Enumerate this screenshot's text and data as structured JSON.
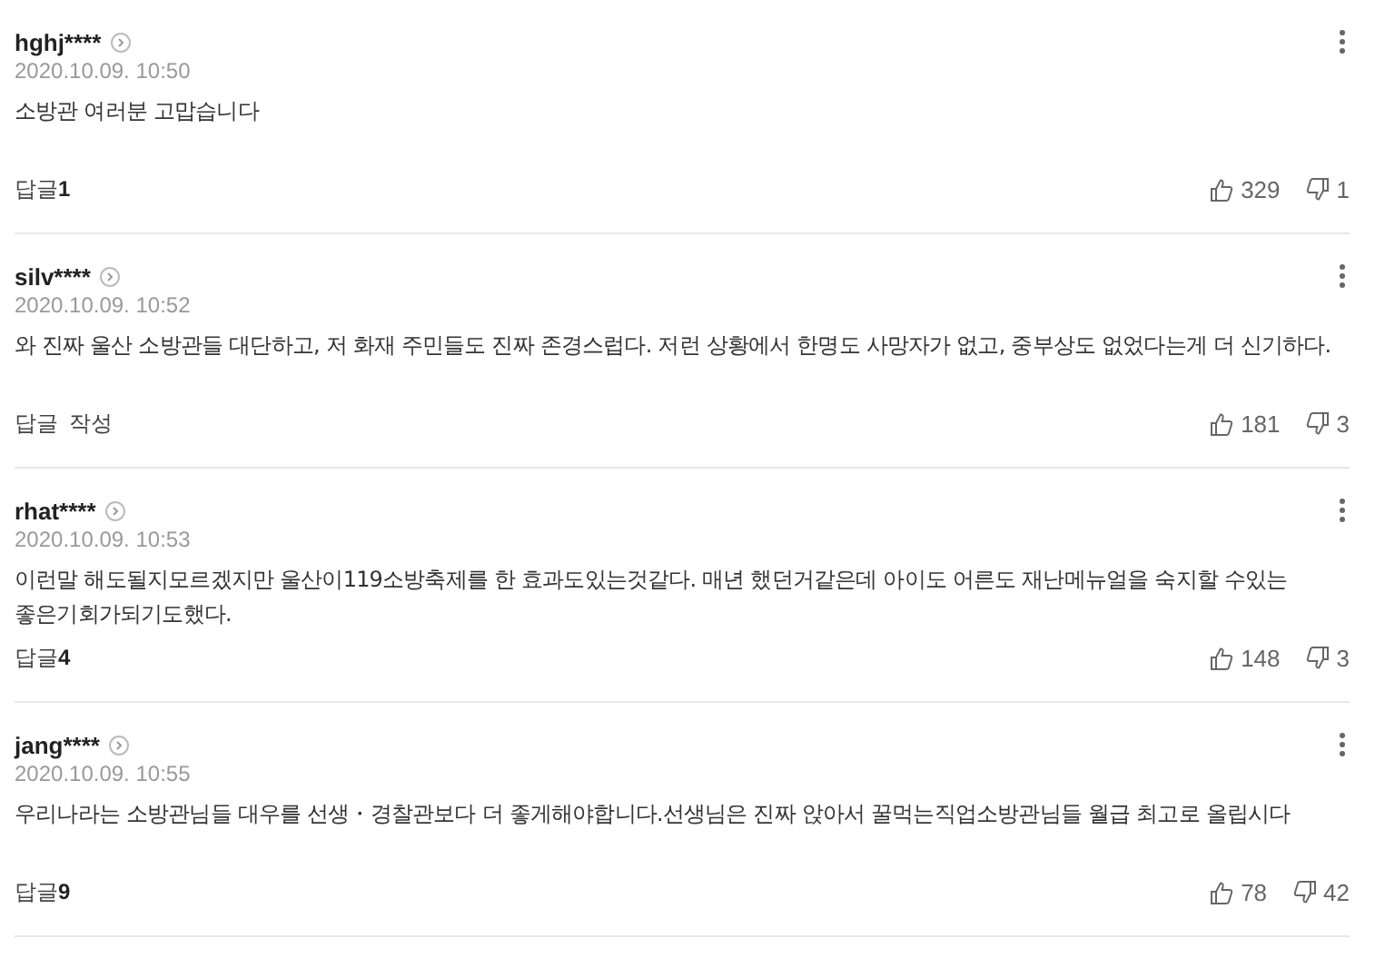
{
  "comments": [
    {
      "user": "hghj****",
      "date": "2020.10.09. 10:50",
      "text": "소방관 여러분 고맙습니다",
      "reply": {
        "label": "답글",
        "count": "1"
      },
      "likes": "329",
      "dislikes": "1"
    },
    {
      "user": "silv****",
      "date": "2020.10.09. 10:52",
      "text": "와 진짜 울산 소방관들 대단하고, 저 화재 주민들도 진짜 존경스럽다. 저런 상황에서 한명도 사망자가 없고, 중부상도 없었다는게 더 신기하다.",
      "reply": {
        "label": "답글 작성"
      },
      "likes": "181",
      "dislikes": "3"
    },
    {
      "user": "rhat****",
      "date": "2020.10.09. 10:53",
      "text": "이런말 해도될지모르겠지만 울산이119소방축제를 한 효과도있는것같다. 매년 했던거같은데 아이도 어른도 재난메뉴얼을 숙지할 수있는 좋은기회가되기도했다.",
      "reply": {
        "label": "답글",
        "count": "4"
      },
      "likes": "148",
      "dislikes": "3"
    },
    {
      "user": "jang****",
      "date": "2020.10.09. 10:55",
      "text": "우리나라는 소방관님들 대우를 선생・경찰관보다 더 좋게해야합니다.선생님은 진짜 앉아서 꿀먹는직업소방관님들 월급 최고로 올립시다",
      "reply": {
        "label": "답글",
        "count": "9"
      },
      "likes": "78",
      "dislikes": "42"
    }
  ]
}
